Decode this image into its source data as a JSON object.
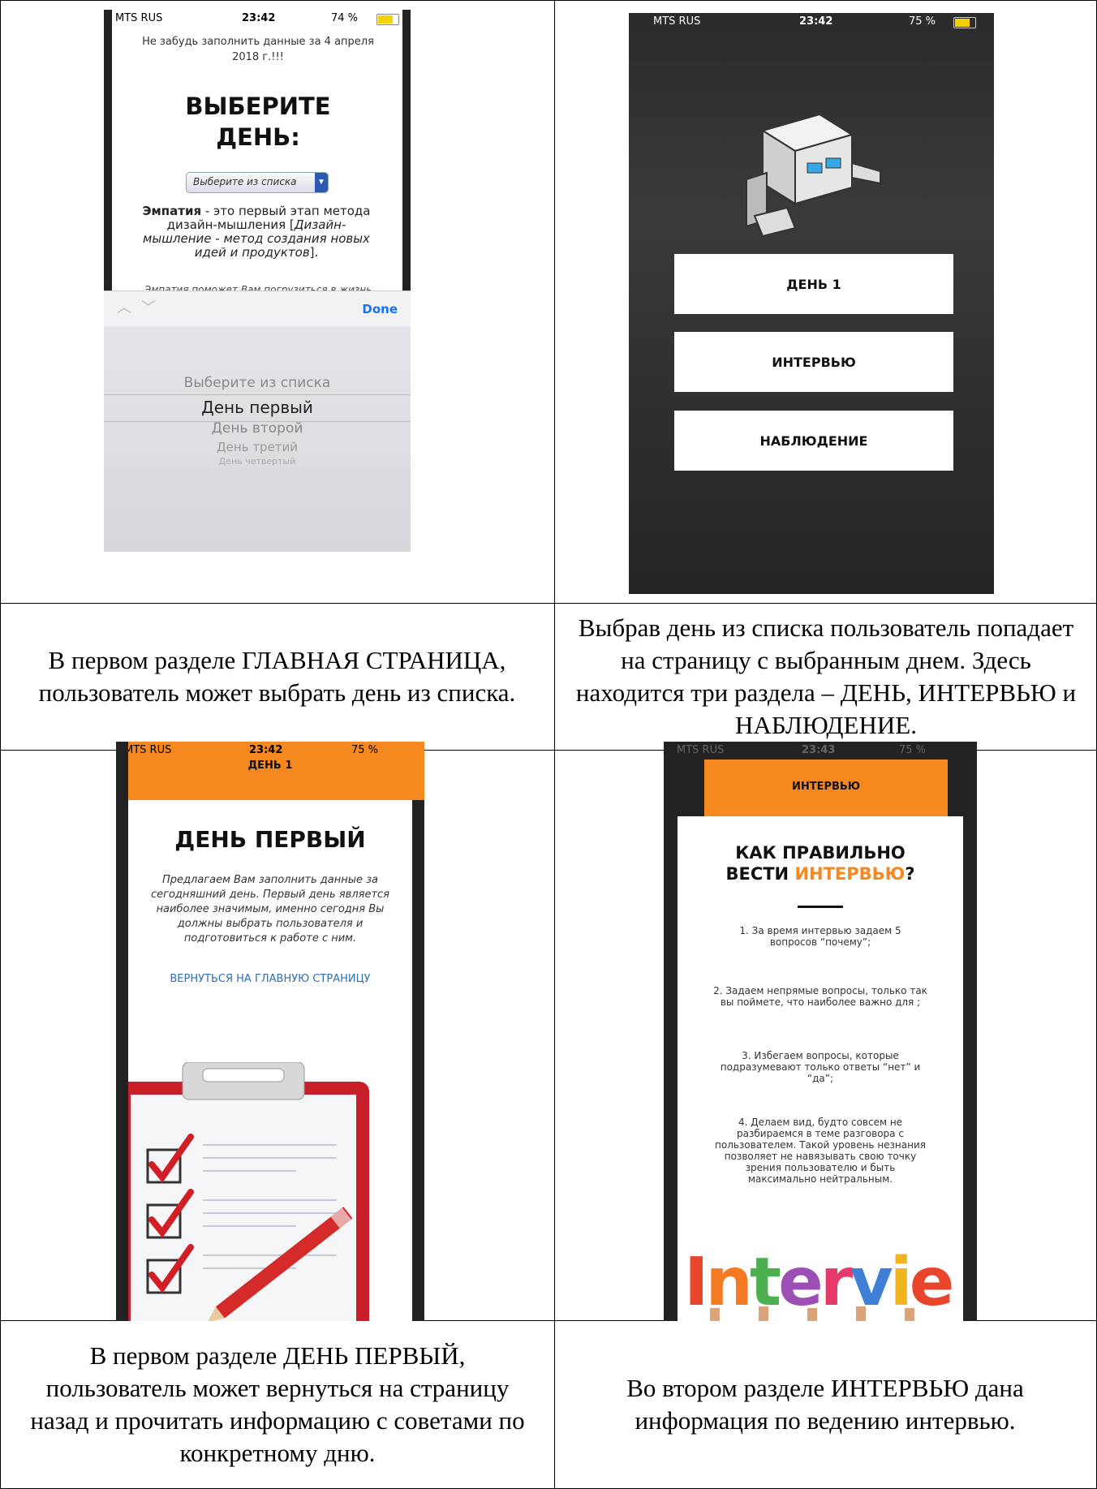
{
  "captions": {
    "c1": "В первом разделе ГЛАВНАЯ СТРАНИЦА, пользователь может выбрать день из списка.",
    "c2": "Выбрав день из списка пользователь попадает на страницу с выбранным днем. Здесь находится три раздела – ДЕНЬ, ИНТЕРВЬЮ и НАБЛЮДЕНИЕ.",
    "c3": "В первом разделе ДЕНЬ ПЕРВЫЙ, пользователь может вернуться на страницу назад и прочитать информацию с советами по конкретному дню.",
    "c4": "Во втором разделе ИНТЕРВЬЮ дана информация по ведению интервью."
  },
  "screen1": {
    "carrier": "MTS RUS",
    "time": "23:42",
    "battery": "74 %",
    "reminder": "Не забудь заполнить данные за 4 апреля 2018 г.!!!",
    "title": "ВЫБЕРИТЕ ДЕНЬ:",
    "select_value": "Выберите из списка",
    "empathy_bold": "Эмпатия",
    "empathy_rest": " - это первый этап метода дизайн-мышления [",
    "empathy_italic": "Дизайн-мышление - метод создания новых идей и продуктов",
    "empathy_end": "].",
    "teaser": "Эмпатия поможет Вам погрузиться в жизнь выбранного пользователя.Для",
    "done": "Done",
    "picker": [
      "Выберите из списка",
      "День первый",
      "День второй",
      "День третий",
      "День четвертый"
    ]
  },
  "screen2": {
    "carrier": "MTS RUS",
    "time": "23:42",
    "battery": "75 %",
    "buttons": [
      "ДЕНЬ 1",
      "ИНТЕРВЬЮ",
      "НАБЛЮДЕНИЕ"
    ]
  },
  "screen3": {
    "carrier": "MTS RUS",
    "time": "23:42",
    "battery": "75 %",
    "header": "ДЕНЬ 1",
    "title": "ДЕНЬ ПЕРВЫЙ",
    "intro": "Предлагаем Вам заполнить данные за сегодняшний день. Первый день является наиболее значимым, именно сегодня Вы должны выбрать пользователя и подготовиться к работе с ним.",
    "back_link": "ВЕРНУТЬСЯ НА ГЛАВНУЮ СТРАНИЦУ"
  },
  "screen4": {
    "carrier": "MTS RUS",
    "time": "23:43",
    "battery": "75 %",
    "header": "ИНТЕРВЬЮ",
    "title_line1": "КАК ПРАВИЛЬНО",
    "title_line2a": "ВЕСТИ ",
    "title_line2b": "ИНТЕРВЬЮ",
    "title_line2c": "?",
    "tips": [
      "1. За время интервью задаем 5 вопросов “почему”;",
      "2. Задаем непрямые вопросы, только так вы поймете, что наиболее важно для ;",
      "3. Избегаем вопросы, которые подразумевают только ответы “нет” и “да”;",
      "4. Делаем вид, будто совсем не разбираемся в теме разговора с пользователем. Такой уровень незнания позволяет не навязывать свою точку зрения пользователю и быть максимально нейтральным."
    ],
    "banner_word": "Interview"
  },
  "colors": {
    "orange": "#f5891f",
    "link_blue": "#2f6fb0",
    "red_check": "#d21f26"
  }
}
